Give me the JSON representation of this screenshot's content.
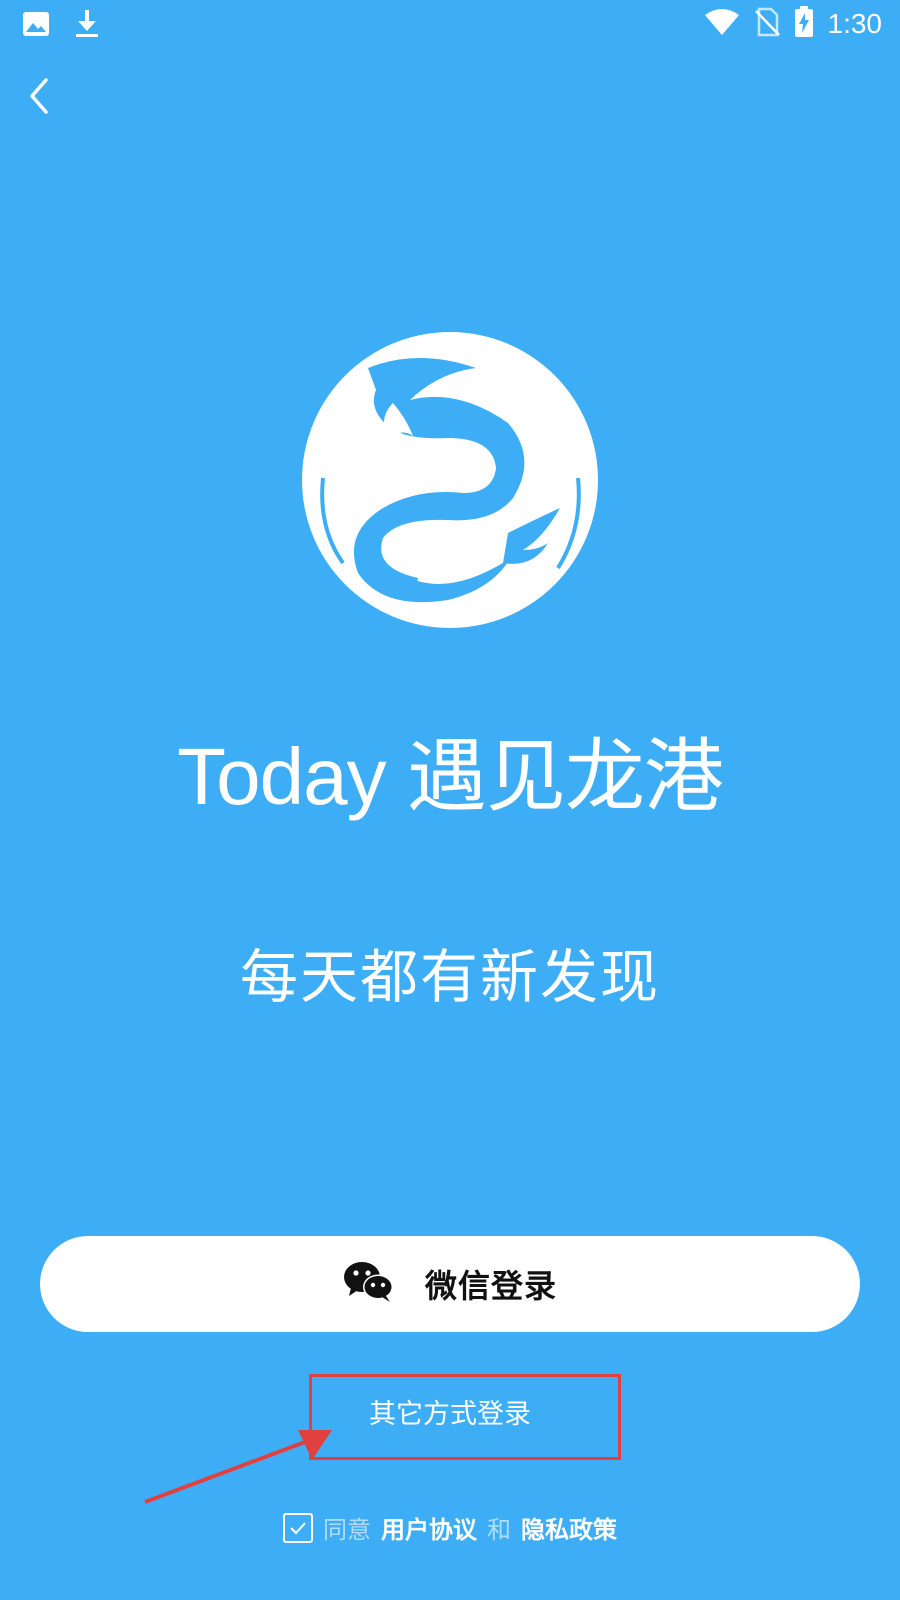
{
  "status_bar": {
    "time": "1:30",
    "left_icons": [
      "image-icon",
      "download-icon"
    ],
    "right_icons": [
      "wifi-icon",
      "no-sim-icon",
      "battery-charging-icon"
    ]
  },
  "app": {
    "title": "Today 遇见龙港",
    "tagline": "每天都有新发现",
    "logo": "dragon-logo"
  },
  "login": {
    "wechat_label": "微信登录",
    "other_label": "其它方式登录"
  },
  "agreement": {
    "checked": true,
    "prefix": "同意",
    "user_agreement": "用户协议",
    "conjunction": "和",
    "privacy_policy": "隐私政策"
  },
  "colors": {
    "background": "#3daef5",
    "button_bg": "#ffffff",
    "annotation": "#e04040"
  }
}
